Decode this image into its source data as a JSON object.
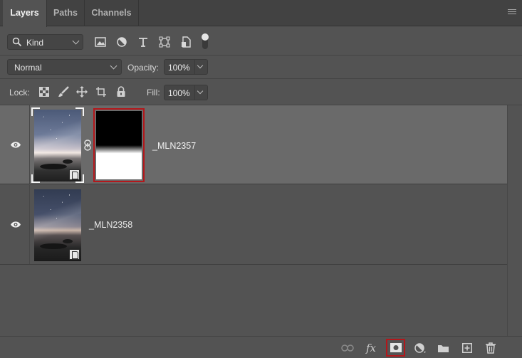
{
  "tabs": [
    {
      "label": "Layers",
      "active": true
    },
    {
      "label": "Paths",
      "active": false
    },
    {
      "label": "Channels",
      "active": false
    }
  ],
  "filter": {
    "kind_label": "Kind",
    "icons": [
      "image-filter-icon",
      "adjustment-filter-icon",
      "type-filter-icon",
      "shape-filter-icon",
      "smart-object-filter-icon",
      "filter-toggle"
    ]
  },
  "blend": {
    "mode": "Normal",
    "opacity_label": "Opacity:",
    "opacity_value": "100%"
  },
  "lock": {
    "label": "Lock:",
    "icons": [
      "lock-transparent-icon",
      "lock-paint-icon",
      "lock-position-icon",
      "lock-artboard-icon",
      "lock-all-icon"
    ],
    "fill_label": "Fill:",
    "fill_value": "100%"
  },
  "layers": [
    {
      "name": "_MLN2357",
      "visible": true,
      "selected": true,
      "has_mask": true,
      "smart_object": true
    },
    {
      "name": "_MLN2358",
      "visible": true,
      "selected": false,
      "has_mask": false,
      "smart_object": true
    }
  ],
  "bottom_bar": {
    "fx_label": "fx",
    "icons": [
      "link-layers-icon",
      "fx-icon",
      "add-mask-icon",
      "adjustment-layer-icon",
      "group-folder-icon",
      "new-layer-icon",
      "delete-layer-icon"
    ]
  },
  "colors": {
    "panel_bg": "#535353",
    "selected_layer_bg": "#6a6a6a",
    "highlight_red": "#b3171b"
  }
}
